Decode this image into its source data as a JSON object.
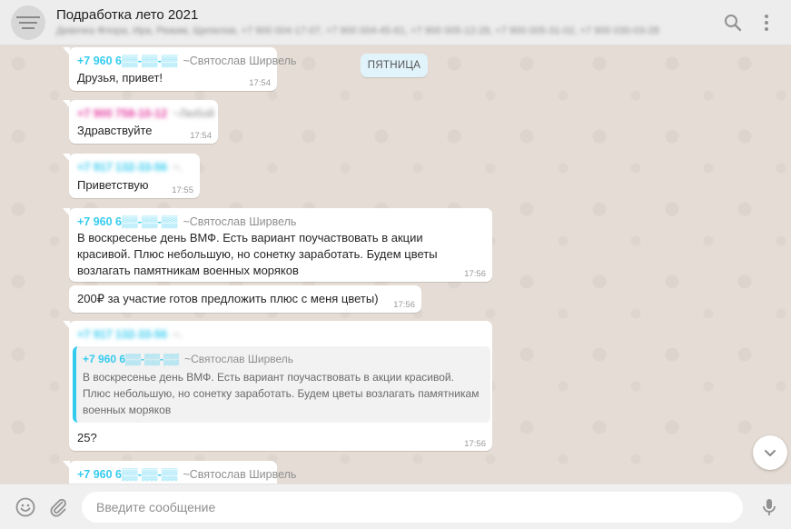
{
  "header": {
    "title": "Подработка лето 2021",
    "subtitle": "Девочка Флора, Ира, Режим, Щепилов, +7 900 004-17-07, +7 900 004-45-61, +7 900 005-12-28, +7 900 005-31-02, +7 900 030-03-28"
  },
  "day_badge": "ПЯТНИЦА",
  "messages": [
    {
      "phone": "+7 960 6▒▒-▒▒-▒▒",
      "alias": "~Святослав Ширвель",
      "text": "Друзья, привет!",
      "time": "17:54"
    },
    {
      "phone": "+7 900 758-10-12",
      "alias": "~Любой",
      "text": "Здравствуйте",
      "time": "17:54"
    },
    {
      "phone": "+7 917 132-33-56",
      "alias": "~.",
      "text": "Приветствую",
      "time": "17:55"
    },
    {
      "phone": "+7 960 6▒▒-▒▒-▒▒",
      "alias": "~Святослав Ширвель",
      "text": "В воскресенье день ВМФ. Есть вариант поучаствовать в акции красивой. Плюс небольшую, но сонетку заработать. Будем цветы возлагать памятникам военных моряков",
      "time": "17:56"
    },
    {
      "text": "200₽ за участие готов предложить плюс с меня цветы)",
      "time": "17:56"
    },
    {
      "phone": "+7 917 132-33-56",
      "alias": "~.",
      "quote": {
        "phone": "+7 960 6▒▒-▒▒-▒▒",
        "alias": "~Святослав Ширвель",
        "text": "В воскресенье день ВМФ. Есть вариант поучаствовать в акции красивой. Плюс небольшую, но сонетку заработать. Будем цветы возлагать памятникам военных моряков"
      },
      "text": "25?",
      "time": "17:56"
    },
    {
      "phone": "+7 960 6▒▒-▒▒-▒▒",
      "alias": "~Святослав Ширвель"
    }
  ],
  "composer": {
    "placeholder": "Введите сообщение"
  },
  "icons": {
    "header": [
      "group-avatar",
      "search-icon",
      "menu-icon"
    ],
    "footer": [
      "emoji-icon",
      "attach-icon",
      "microphone-icon"
    ],
    "scroll": "chevron-down-icon"
  },
  "colors": {
    "phone": "#35cbf0",
    "phone_alt": "#e542a3",
    "day_badge_bg": "#e1f3fb",
    "chat_bg": "#e5ddd5",
    "header_bg": "#ededed"
  }
}
